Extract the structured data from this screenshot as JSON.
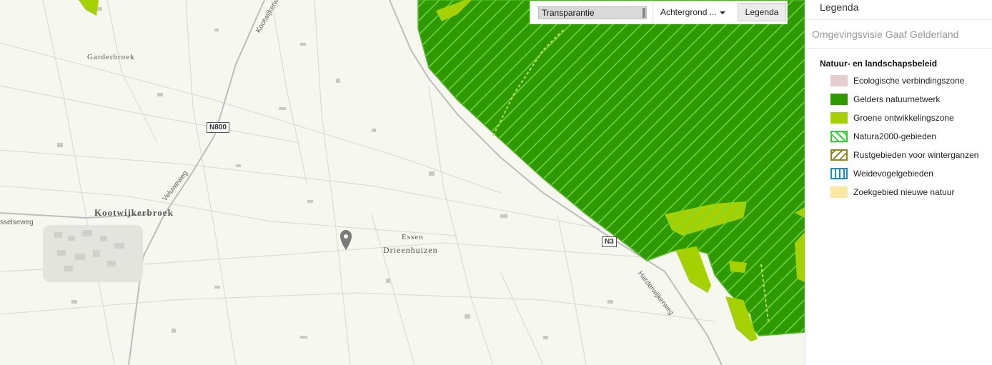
{
  "map": {
    "places": [
      {
        "label": "Garderbroek"
      },
      {
        "label": "Kootwijkerbroek"
      },
      {
        "label": "Essen"
      },
      {
        "label": "Drieenhuizen"
      }
    ],
    "roads": {
      "veluweweg": "Veluweweg",
      "harderwijkerweg": "Harderwijkerweg",
      "kootwijkerweg": "Kootwijkerweg",
      "selseweg": "sselseweg",
      "n800": "N800",
      "n3": "N3"
    }
  },
  "toolbar": {
    "transparency_label": "Transparantie",
    "background_label": "Achtergrond ...",
    "legend_button": "Legenda"
  },
  "panel": {
    "title": "Legenda",
    "subtitle": "Omgevingsvisie Gaaf Gelderland",
    "section": "Natuur- en landschapsbeleid",
    "items": [
      {
        "label": "Ecologische verbindingszone",
        "style": "fill",
        "color": "#e6cdcd"
      },
      {
        "label": "Gelders natuurnetwerk",
        "style": "fill",
        "color": "#2e9900"
      },
      {
        "label": "Groene ontwikkelingszone",
        "style": "fill",
        "color": "#a6d100"
      },
      {
        "label": "Natura2000-gebieden",
        "style": "hatch",
        "color": "#33cc33"
      },
      {
        "label": "Rustgebieden voor winterganzen",
        "style": "hatch",
        "color": "#8f8a18"
      },
      {
        "label": "Weidevogelgebieden",
        "style": "vlines",
        "color": "#1a8fc4"
      },
      {
        "label": "Zoekgebied nieuwe natuur",
        "style": "fill",
        "color": "#fbe7a2"
      }
    ]
  },
  "colors": {
    "nature_network": "#2e9900",
    "green_zone": "#a6d100",
    "natura_hatch": "#66dd33",
    "pin": "#7a7a7a"
  }
}
